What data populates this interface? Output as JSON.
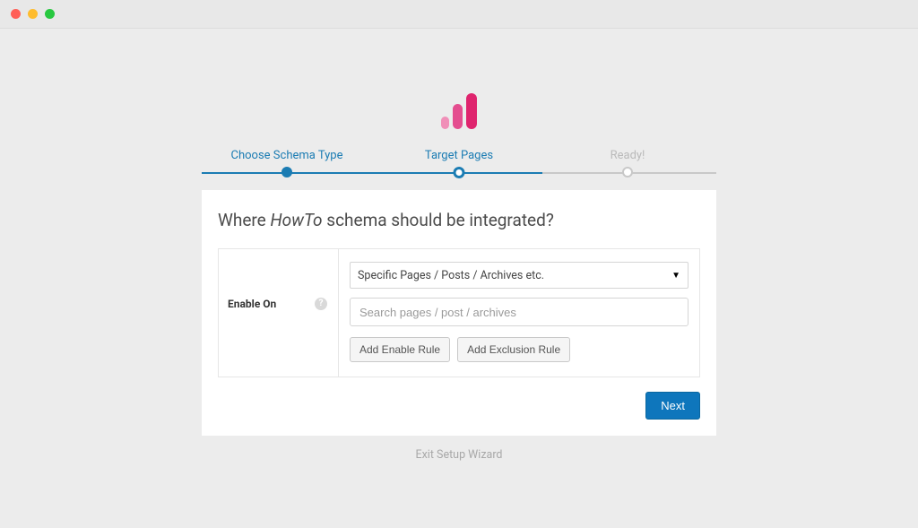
{
  "window": {
    "controls": [
      "close",
      "minimize",
      "zoom"
    ]
  },
  "stepper": {
    "steps": [
      {
        "label": "Choose Schema Type",
        "state": "done"
      },
      {
        "label": "Target Pages",
        "state": "current"
      },
      {
        "label": "Ready!",
        "state": "todo"
      }
    ]
  },
  "title": {
    "prefix": "Where ",
    "schema_name": "HowTo",
    "suffix": " schema should be integrated?"
  },
  "field": {
    "label": "Enable On",
    "help_glyph": "?",
    "select_value": "Specific Pages / Posts / Archives etc.",
    "search_placeholder": "Search pages / post / archives",
    "add_enable_label": "Add Enable Rule",
    "add_exclusion_label": "Add Exclusion Rule"
  },
  "footer": {
    "next_label": "Next",
    "exit_label": "Exit Setup Wizard"
  },
  "colors": {
    "accent": "#1b7cb3",
    "primary_button": "#0e76bc",
    "logo_bars": [
      "#f08fb8",
      "#e44d8f",
      "#df246e"
    ]
  }
}
